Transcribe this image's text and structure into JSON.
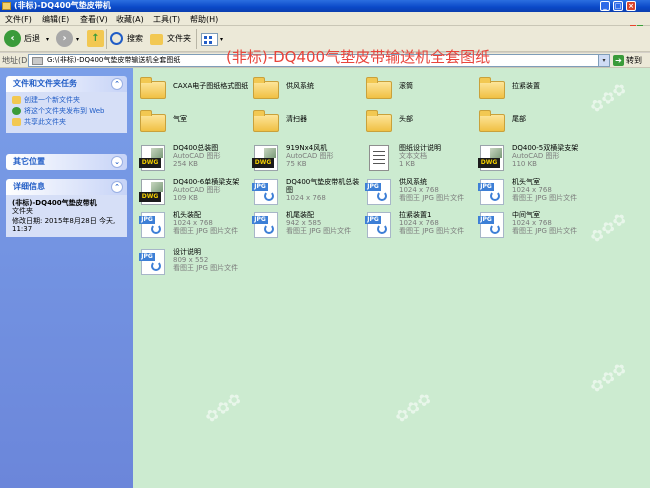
{
  "window": {
    "title": "(非标)-DQ400气垫皮带机"
  },
  "menu": [
    "文件(F)",
    "编辑(E)",
    "查看(V)",
    "收藏(A)",
    "工具(T)",
    "帮助(H)"
  ],
  "toolbar": {
    "back": "后退",
    "search": "搜索",
    "folders": "文件夹"
  },
  "overlay_title": "(非标)-DQ400气垫皮带输送机全套图纸",
  "address": {
    "label": "地址(D)",
    "path": "G:\\(非标)-DQ400气垫皮带输送机全套图纸",
    "go": "转到"
  },
  "tasks": {
    "title": "文件和文件夹任务",
    "links": [
      "创建一个新文件夹",
      "将这个文件夹发布到 Web",
      "共享此文件夹"
    ]
  },
  "other_places": {
    "title": "其它位置"
  },
  "details": {
    "title": "详细信息",
    "name": "(非标)-DQ400气垫皮带机",
    "type": "文件夹",
    "modified": "修改日期: 2015年8月28日 今天, 11:37"
  },
  "items": [
    {
      "name": "CAXA电子图纸格式图纸",
      "kind": "folder"
    },
    {
      "name": "供风系统",
      "kind": "folder"
    },
    {
      "name": "滚筒",
      "kind": "folder"
    },
    {
      "name": "拉紧装置",
      "kind": "folder"
    },
    {
      "name": "气室",
      "kind": "folder"
    },
    {
      "name": "清扫器",
      "kind": "folder"
    },
    {
      "name": "头部",
      "kind": "folder"
    },
    {
      "name": "尾部",
      "kind": "folder"
    },
    {
      "name": "DQ400总装图",
      "kind": "dwg",
      "line1": "AutoCAD 图形",
      "line2": "254 KB"
    },
    {
      "name": "919Nx4风机",
      "kind": "dwg",
      "line1": "AutoCAD 图形",
      "line2": "75 KB"
    },
    {
      "name": "图纸设计说明",
      "kind": "txt",
      "line1": "文本文档",
      "line2": "1 KB"
    },
    {
      "name": "DQ400-5双横梁支架",
      "kind": "dwg",
      "line1": "AutoCAD 图形",
      "line2": "110 KB"
    },
    {
      "name": "DQ400-6单横梁支架",
      "kind": "dwg",
      "line1": "AutoCAD 图形",
      "line2": "109 KB"
    },
    {
      "name": "DQ400气垫皮带机总装图",
      "kind": "jpg",
      "line1": "1024 x 768",
      "line2": ""
    },
    {
      "name": "供风系统",
      "kind": "jpg",
      "line1": "1024 x 768",
      "line2": "看图王 JPG 图片文件"
    },
    {
      "name": "机头气室",
      "kind": "jpg",
      "line1": "1024 x 768",
      "line2": "看图王 JPG 图片文件"
    },
    {
      "name": "机头装配",
      "kind": "jpg",
      "line1": "1024 x 768",
      "line2": "看图王 JPG 图片文件"
    },
    {
      "name": "机尾装配",
      "kind": "jpg",
      "line1": "942 x 585",
      "line2": "看图王 JPG 图片文件"
    },
    {
      "name": "拉紧装置1",
      "kind": "jpg",
      "line1": "1024 x 768",
      "line2": "看图王 JPG 图片文件"
    },
    {
      "name": "中间气室",
      "kind": "jpg",
      "line1": "1024 x 768",
      "line2": "看图王 JPG 图片文件"
    },
    {
      "name": "设计说明",
      "kind": "jpg",
      "line1": "809 x 552",
      "line2": "看图王 JPG 图片文件"
    }
  ]
}
